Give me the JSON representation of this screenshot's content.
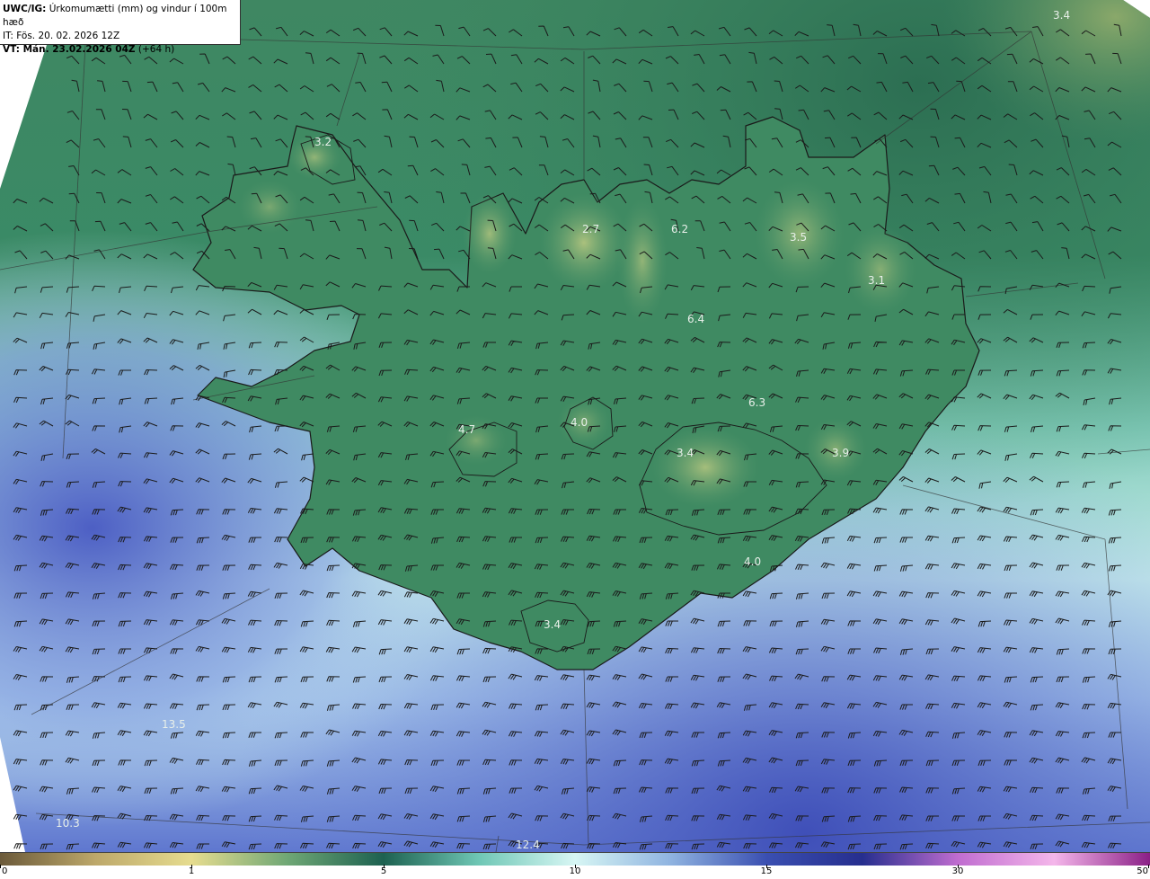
{
  "header": {
    "model": "UWC/IG:",
    "description": "Úrkomumætti (mm) og vindur í 100m hæð",
    "it_label": "IT:",
    "it_value": "Fös. 20. 02. 2026 12Z",
    "vt_label": "VT: Mán. 23.02.2026 04Z",
    "vt_extra": "(+64 h)"
  },
  "map_labels": [
    {
      "id": "label-n-corner",
      "text": "3.4"
    },
    {
      "id": "label-westfjords",
      "text": "3.2"
    },
    {
      "id": "label-north-a",
      "text": "2.7"
    },
    {
      "id": "label-north-b",
      "text": "6.2"
    },
    {
      "id": "label-northeast",
      "text": "3.5"
    },
    {
      "id": "label-east",
      "text": "3.1"
    },
    {
      "id": "label-center-a",
      "text": "6.4"
    },
    {
      "id": "label-center-b",
      "text": "6.3"
    },
    {
      "id": "label-west-a",
      "text": "4.7"
    },
    {
      "id": "label-west-b",
      "text": "4.0"
    },
    {
      "id": "label-vatnajokull",
      "text": "3.4"
    },
    {
      "id": "label-southeast",
      "text": "3.9"
    },
    {
      "id": "label-south-a",
      "text": "4.0"
    },
    {
      "id": "label-south-b",
      "text": "3.4"
    },
    {
      "id": "label-sw-sea",
      "text": "13.5"
    },
    {
      "id": "label-sw-corner",
      "text": "10.3"
    },
    {
      "id": "label-south-sea",
      "text": "12.4"
    }
  ],
  "colorbar": {
    "ticks": [
      "0",
      "1",
      "5",
      "10",
      "15",
      "30",
      "50"
    ],
    "colors": [
      "#6b5a3a",
      "#bda86a",
      "#e6dc8f",
      "#6fa775",
      "#1d6150",
      "#6fc7b5",
      "#d7f6f4",
      "#8fb3e0",
      "#3a4fb1",
      "#262e8e",
      "#c06dd0",
      "#f4b6ea",
      "#8a1f86"
    ]
  },
  "colors": {
    "land": "#3f8a62",
    "sea_north": "#2d7456",
    "sea_south": "#4f66c8"
  }
}
